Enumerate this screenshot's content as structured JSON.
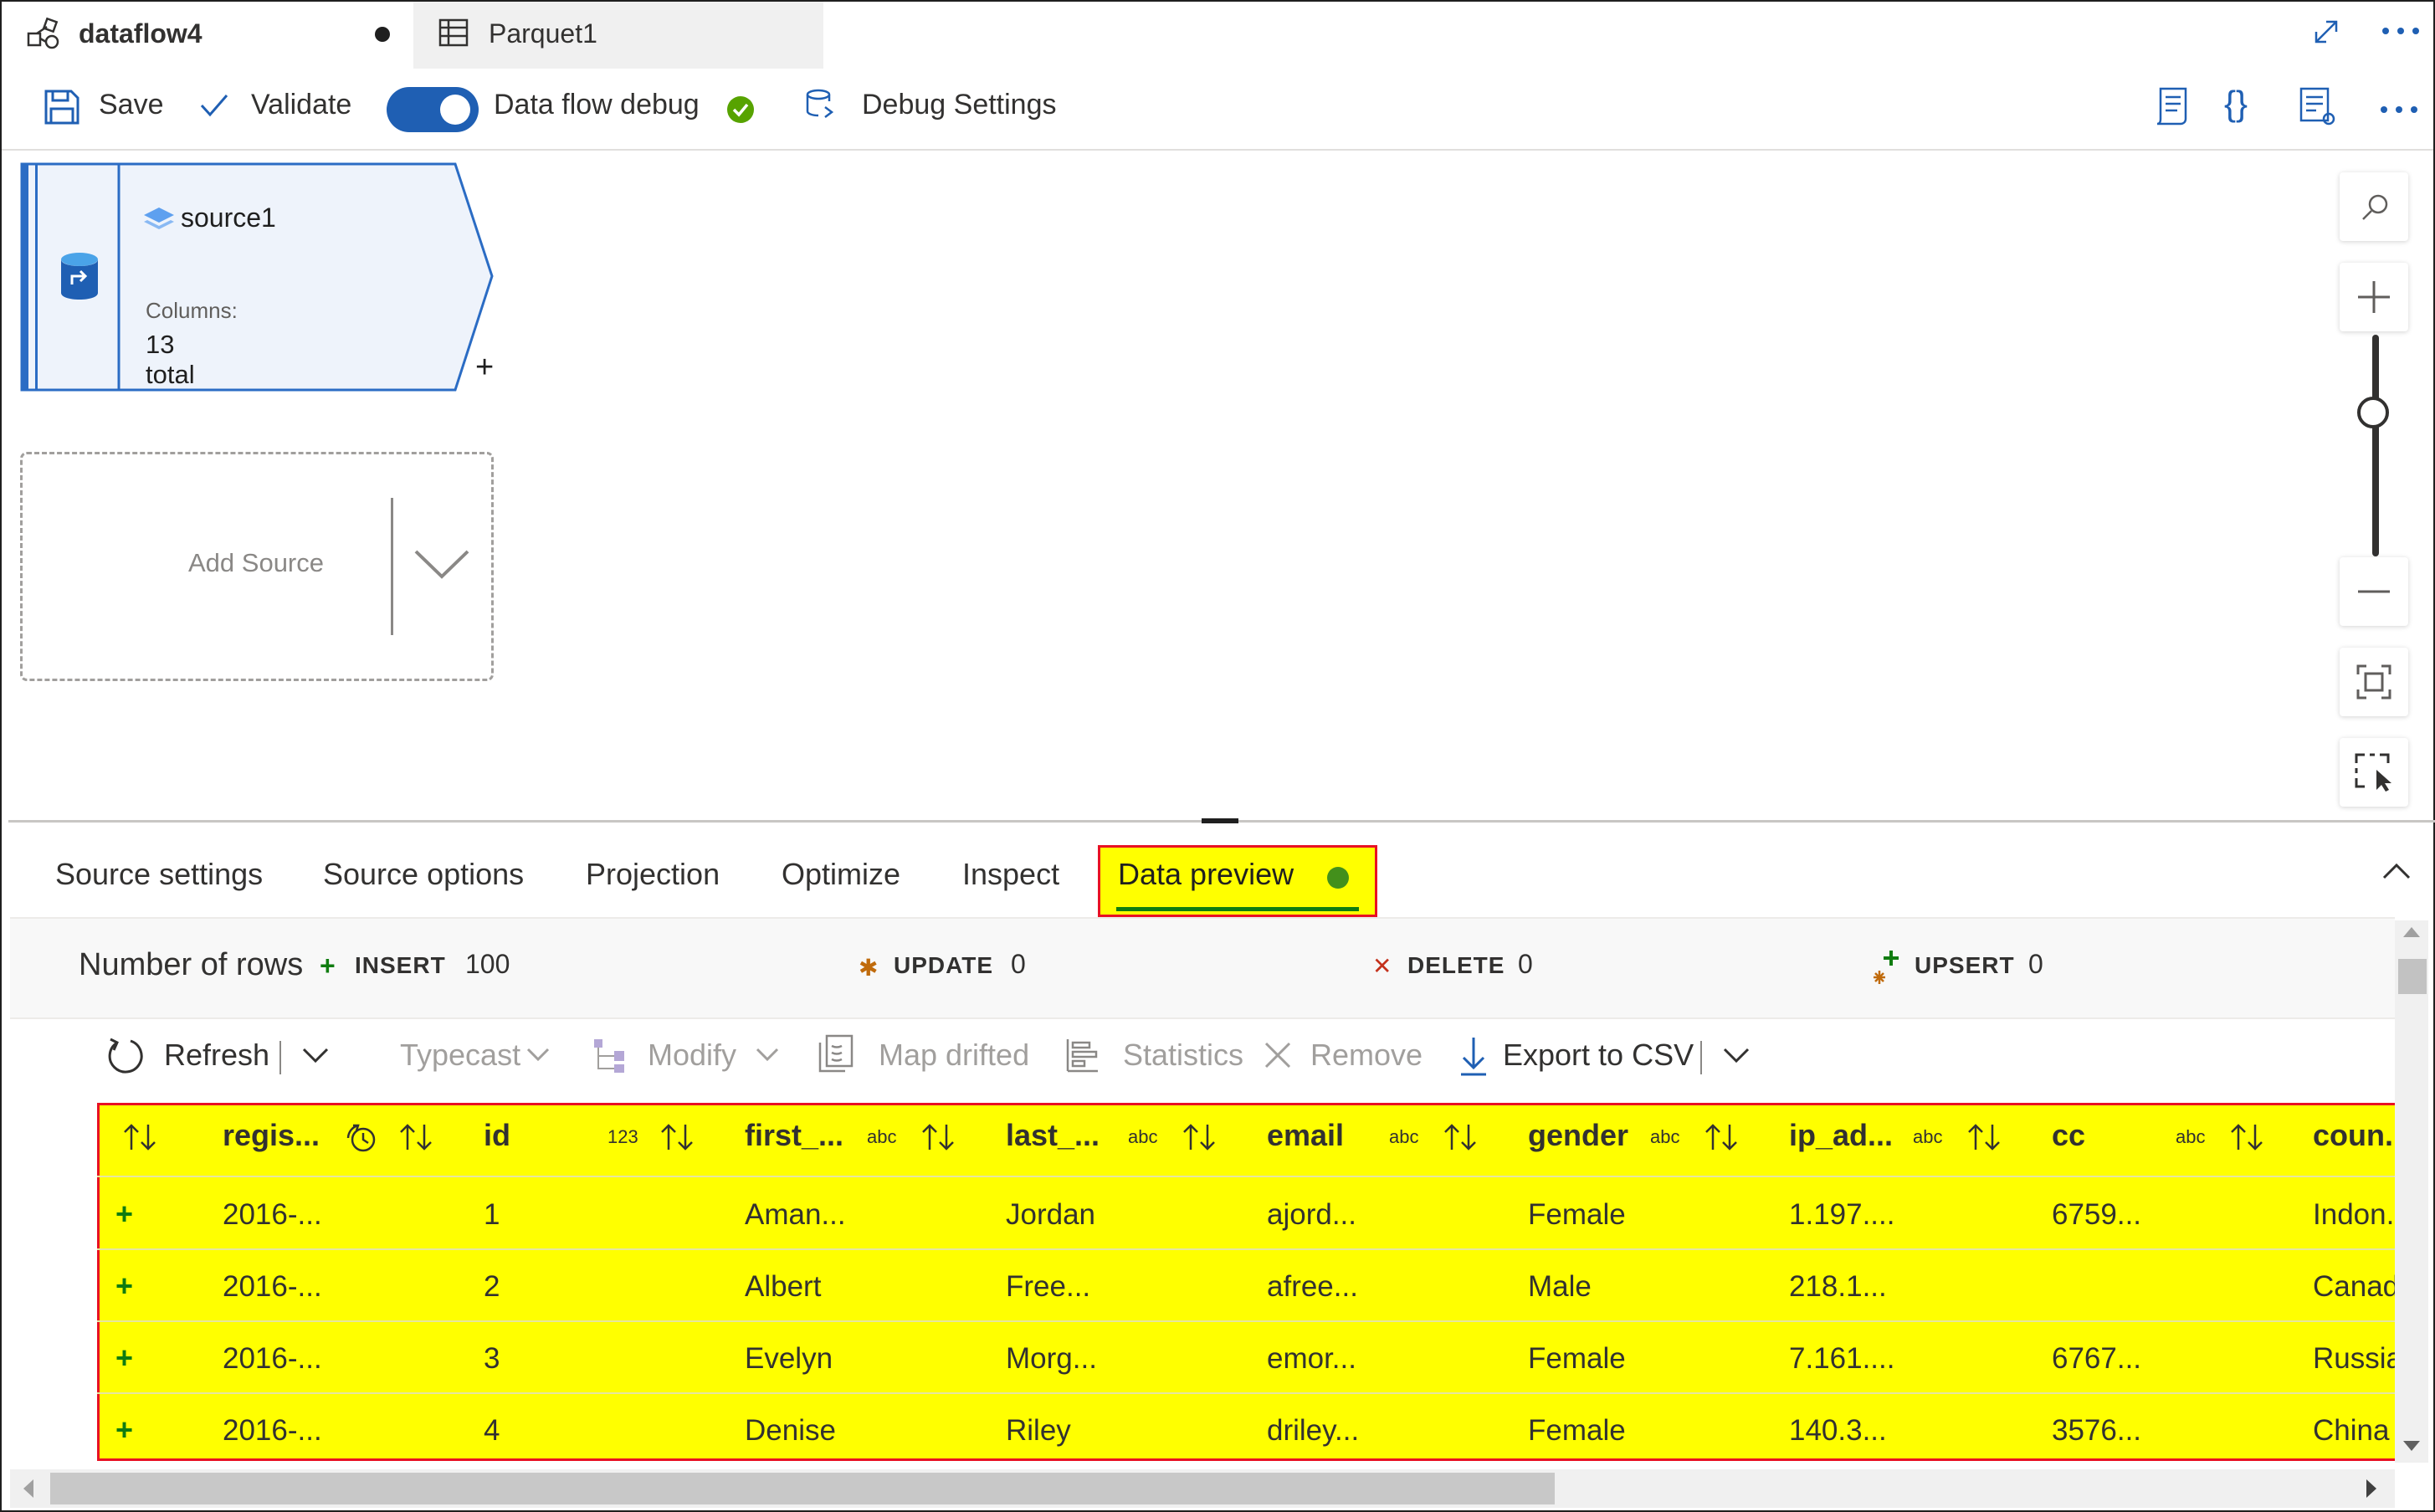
{
  "tabs": [
    {
      "label": "dataflow4",
      "active": true,
      "unsaved": true,
      "icon": "dataflow-icon"
    },
    {
      "label": "Parquet1",
      "active": false,
      "icon": "table-icon"
    }
  ],
  "toolbar": {
    "save_label": "Save",
    "validate_label": "Validate",
    "debug_label": "Data flow debug",
    "debug_on": true,
    "debug_settings_label": "Debug Settings"
  },
  "canvas": {
    "node": {
      "name": "source1",
      "columns_label": "Columns:",
      "columns_value": "13 total"
    },
    "add_source_label": "Add Source"
  },
  "panel": {
    "tabs": [
      "Source settings",
      "Source options",
      "Projection",
      "Optimize",
      "Inspect",
      "Data preview"
    ],
    "active_tab": "Data preview"
  },
  "rows_summary": {
    "label": "Number of rows",
    "insert": {
      "label": "INSERT",
      "value": "100"
    },
    "update": {
      "label": "UPDATE",
      "value": "0"
    },
    "delete": {
      "label": "DELETE",
      "value": "0"
    },
    "upsert": {
      "label": "UPSERT",
      "value": "0"
    }
  },
  "actions": {
    "refresh": "Refresh",
    "typecast": "Typecast",
    "modify": "Modify",
    "map_drifted": "Map drifted",
    "statistics": "Statistics",
    "remove": "Remove",
    "export": "Export to CSV"
  },
  "grid": {
    "columns": [
      {
        "name": "regis...",
        "type": "date-icon"
      },
      {
        "name": "id",
        "type": "123"
      },
      {
        "name": "first_...",
        "type": "abc"
      },
      {
        "name": "last_...",
        "type": "abc"
      },
      {
        "name": "email",
        "type": "abc"
      },
      {
        "name": "gender",
        "type": "abc"
      },
      {
        "name": "ip_ad...",
        "type": "abc"
      },
      {
        "name": "cc",
        "type": "abc"
      },
      {
        "name": "coun..",
        "type": ""
      }
    ],
    "rows": [
      [
        "2016-...",
        "1",
        "Aman...",
        "Jordan",
        "ajord...",
        "Female",
        "1.197....",
        "6759...",
        "Indon."
      ],
      [
        "2016-...",
        "2",
        "Albert",
        "Free...",
        "afree...",
        "Male",
        "218.1...",
        "",
        "Canad"
      ],
      [
        "2016-...",
        "3",
        "Evelyn",
        "Morg...",
        "emor...",
        "Female",
        "7.161....",
        "6767...",
        "Russia"
      ],
      [
        "2016-...",
        "4",
        "Denise",
        "Riley",
        "driley...",
        "Female",
        "140.3...",
        "3576...",
        "China"
      ]
    ]
  },
  "colors": {
    "accent": "#1f5fb3",
    "success": "#107c10",
    "highlight": "#ffff00",
    "highlight_border": "#e81123"
  }
}
